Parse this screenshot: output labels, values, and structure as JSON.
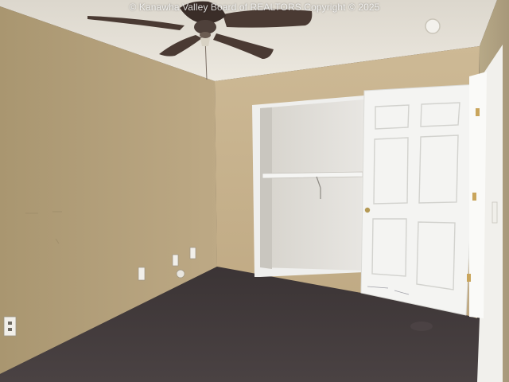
{
  "photo": {
    "watermark": "© Kanawha Valley Board of REALTORS Copyright © 2025",
    "colors": {
      "ceiling": "#e6e1d7",
      "left_wall": "#b5a078",
      "back_wall": "#c8b48d",
      "right_wall": "#b2a382",
      "carpet": "#3f3839",
      "closet_interior": "#e3e1dc",
      "door": "#f4f4f4",
      "fan_blade": "#4a3a33"
    },
    "objects": [
      "ceiling-fan-icon",
      "closet-door-icon",
      "wall-outlet-icon",
      "closet-rod-icon"
    ]
  }
}
